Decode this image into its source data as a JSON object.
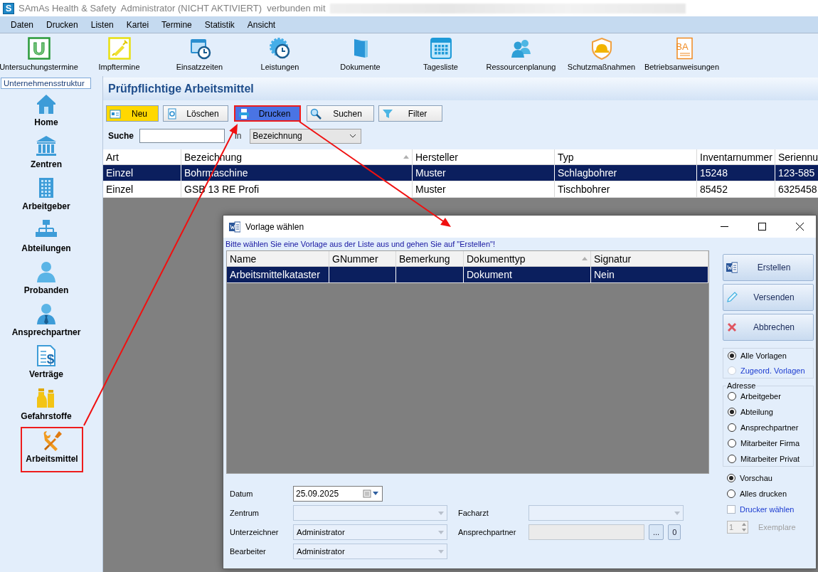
{
  "window": {
    "logo": "S",
    "title": "SAmAs Health & Safety  Administrator (NICHT AKTIVIERT)  verbunden mit"
  },
  "menu": [
    "Daten",
    "Drucken",
    "Listen",
    "Kartei",
    "Termine",
    "Statistik",
    "Ansicht"
  ],
  "toolbar": [
    {
      "label": "Untersuchungstermine",
      "kind": "letter",
      "icon_text": "U"
    },
    {
      "label": "Impftermine",
      "kind": "syringe"
    },
    {
      "label": "Einsatzzeiten",
      "kind": "calendar-clock"
    },
    {
      "label": "Leistungen",
      "kind": "gear-clock"
    },
    {
      "label": "Dokumente",
      "kind": "folder"
    },
    {
      "label": "Tagesliste",
      "kind": "calendar"
    },
    {
      "label": "Ressourcenplanung",
      "kind": "people"
    },
    {
      "label": "Schutzmaßnahmen",
      "kind": "helmet"
    },
    {
      "label": "Betriebsanweisungen",
      "kind": "letter-doc",
      "icon_text": "BA"
    }
  ],
  "sidebar": {
    "tab": "Unternehmensstruktur",
    "items": [
      {
        "label": "Home",
        "kind": "home",
        "highlighted": false
      },
      {
        "label": "Zentren",
        "kind": "columns",
        "highlighted": false
      },
      {
        "label": "Arbeitgeber",
        "kind": "office",
        "highlighted": false
      },
      {
        "label": "Abteilungen",
        "kind": "org",
        "highlighted": false
      },
      {
        "label": "Probanden",
        "kind": "person",
        "highlighted": false
      },
      {
        "label": "Ansprechpartner",
        "kind": "person-tie",
        "highlighted": false
      },
      {
        "label": "Verträge",
        "kind": "contract",
        "icon_text": "$",
        "highlighted": false
      },
      {
        "label": "Gefahrstoffe",
        "kind": "bottles",
        "highlighted": false
      },
      {
        "label": "Arbeitsmittel",
        "kind": "tools",
        "highlighted": true
      }
    ]
  },
  "main": {
    "title": "Prüfpflichtige Arbeitsmittel",
    "buttons": [
      {
        "label": "Neu",
        "kind": "new",
        "highlighted": false
      },
      {
        "label": "Löschen",
        "kind": "delete",
        "highlighted": false
      },
      {
        "label": "Drucken",
        "kind": "print",
        "highlighted": true
      },
      {
        "label": "Suchen",
        "kind": "search",
        "highlighted": false
      },
      {
        "label": "Filter",
        "kind": "filter",
        "highlighted": false
      }
    ],
    "search": {
      "label": "Suche",
      "in_label": "in",
      "scope": "Bezeichnung"
    },
    "table": {
      "columns": [
        {
          "label": "Art",
          "sorted": false
        },
        {
          "label": "Bezeichnung",
          "sorted": true
        },
        {
          "label": "Hersteller",
          "sorted": false
        },
        {
          "label": "Typ",
          "sorted": false
        },
        {
          "label": "Inventarnummer",
          "sorted": false
        },
        {
          "label": "Seriennu",
          "sorted": false
        }
      ],
      "rows": [
        {
          "selected": true,
          "cells": [
            "Einzel",
            "Bohrmaschine",
            "Muster",
            "Schlagbohrer",
            "15248",
            "123-585"
          ]
        },
        {
          "selected": false,
          "cells": [
            "Einzel",
            "GSB 13 RE Profi",
            "Muster",
            "Tischbohrer",
            "85452",
            "6325458"
          ]
        }
      ]
    }
  },
  "dialog": {
    "title": "Vorlage wählen",
    "hint": "Bitte wählen Sie eine Vorlage aus der Liste aus und gehen Sie auf \"Erstellen\"!",
    "table": {
      "columns": [
        {
          "label": "Name",
          "sorted": false
        },
        {
          "label": "GNummer",
          "sorted": false
        },
        {
          "label": "Bemerkung",
          "sorted": false
        },
        {
          "label": "Dokumenttyp",
          "sorted": true
        },
        {
          "label": "Signatur",
          "sorted": false
        }
      ],
      "rows": [
        {
          "selected": true,
          "cells": [
            "Arbeitsmittelkataster",
            "",
            "",
            "Dokument",
            "Nein"
          ]
        }
      ]
    },
    "actions": [
      {
        "label": "Erstellen",
        "kind": "word"
      },
      {
        "label": "Versenden",
        "kind": "pencil"
      },
      {
        "label": "Abbrechen",
        "kind": "cancel"
      }
    ],
    "template_filter": [
      {
        "label": "Alle Vorlagen",
        "selected": true
      },
      {
        "label": "Zugeord. Vorlagen",
        "selected": false
      }
    ],
    "address": {
      "label": "Adresse",
      "options": [
        {
          "label": "Arbeitgeber",
          "selected": false
        },
        {
          "label": "Abteilung",
          "selected": true
        },
        {
          "label": "Ansprechpartner",
          "selected": false
        },
        {
          "label": "Mitarbeiter Firma",
          "selected": false
        },
        {
          "label": "Mitarbeiter Privat",
          "selected": false
        }
      ]
    },
    "output": [
      {
        "label": "Vorschau",
        "selected": true
      },
      {
        "label": "Alles drucken",
        "selected": false
      }
    ],
    "printer_choice": {
      "label": "Drucker wählen",
      "checked": false
    },
    "copies": {
      "value": "1",
      "label": "Exemplare",
      "disabled": true
    },
    "form": {
      "date": {
        "label": "Datum",
        "value": "25.09.2025"
      },
      "fields": [
        {
          "label": "Zentrum",
          "kind": "combo"
        },
        {
          "label": "Facharzt",
          "kind": "combo"
        },
        {
          "label": "Unterzeichner",
          "kind": "combo",
          "value": "Administrator"
        },
        {
          "label": "Ansprechpartner",
          "kind": "picker",
          "button": "...",
          "count": "0"
        },
        {
          "label": "Bearbeiter",
          "kind": "combo",
          "value": "Administrator"
        }
      ]
    }
  }
}
